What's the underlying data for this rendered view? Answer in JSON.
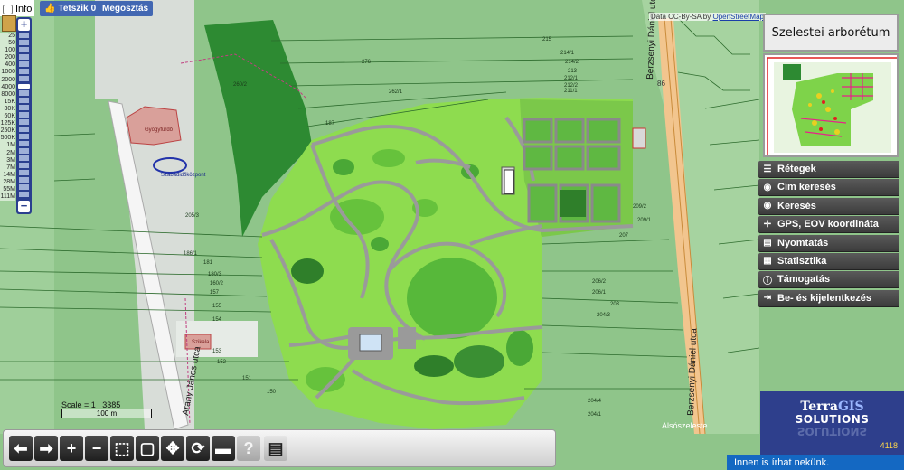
{
  "header": {
    "info_label": "Info",
    "fb_like_label": "Tetszik",
    "fb_like_count": "0",
    "fb_share_label": "Megosztás"
  },
  "zoom": {
    "in_label": "+",
    "out_label": "−",
    "scales": [
      "25",
      "50",
      "100",
      "200",
      "400",
      "1000",
      "2000",
      "4000",
      "8000",
      "15K",
      "30K",
      "60K",
      "125K",
      "250K",
      "500K",
      "1M",
      "2M",
      "3M",
      "7M",
      "14M",
      "28M",
      "55M",
      "111M"
    ],
    "current_scale_index": 7
  },
  "attribution": {
    "prefix": "Data CC-By-SA by",
    "link": "OpenStreetMap"
  },
  "map_labels": {
    "street_1": "Berzsenyi Dániel utca",
    "street_2": "Berzsenyi Dániel utca",
    "street_3": "Arany János utca",
    "street_4": "Alsószeleste",
    "label_gyogyfurdo": "Gyógyfürdő",
    "label_szabadidokozpont": "Szabadidőközpont",
    "label_szikala": "Szikala",
    "road_86": "86",
    "parcels": [
      "215",
      "214/1",
      "214/2",
      "213",
      "212/1",
      "212/2",
      "211/1",
      "209/2",
      "209/1",
      "207",
      "206/2",
      "206/1",
      "204/1",
      "203",
      "204/4",
      "204/3",
      "187",
      "186/1",
      "181",
      "180/3",
      "160/2",
      "157",
      "155",
      "154",
      "153",
      "152",
      "151",
      "150",
      "205/3",
      "276",
      "260/2",
      "262/1"
    ]
  },
  "scale": {
    "label": "Scale = 1 : 3385",
    "bar_label": "100 m"
  },
  "side_panel": {
    "title": "Szelestei arborétum",
    "menu": [
      {
        "icon": "layers-icon",
        "label": "Rétegek"
      },
      {
        "icon": "eye-icon",
        "label": "Cím keresés"
      },
      {
        "icon": "eye-icon",
        "label": "Keresés"
      },
      {
        "icon": "crosshair-icon",
        "label": "GPS, EOV koordináta"
      },
      {
        "icon": "printer-icon",
        "label": "Nyomtatás"
      },
      {
        "icon": "table-icon",
        "label": "Statisztika"
      },
      {
        "icon": "info-icon",
        "label": "Támogatás"
      },
      {
        "icon": "login-icon",
        "label": "Be- és kijelentkezés"
      }
    ]
  },
  "logo": {
    "line1_prefix": "Terra",
    "line1_accent": "GIS",
    "line2": "SOLUTIONS",
    "counter": "4118"
  },
  "chat": {
    "label": "Innen is írhat nekünk."
  },
  "toolbar": {
    "tools": [
      {
        "name": "back-button",
        "glyph": "⬅",
        "state": "active"
      },
      {
        "name": "forward-button",
        "glyph": "➡",
        "state": "active"
      },
      {
        "name": "zoom-in-button",
        "glyph": "+",
        "state": "active"
      },
      {
        "name": "zoom-out-button",
        "glyph": "−",
        "state": "active"
      },
      {
        "name": "zoom-box-button",
        "glyph": "⬚",
        "state": "active"
      },
      {
        "name": "full-extent-button",
        "glyph": "▢",
        "state": "active"
      },
      {
        "name": "pan-button",
        "glyph": "✥",
        "state": "active"
      },
      {
        "name": "rotate-button",
        "glyph": "⟳",
        "state": "active"
      },
      {
        "name": "measure-button",
        "glyph": "▬",
        "state": "active"
      },
      {
        "name": "help-button",
        "glyph": "?",
        "state": "disabled"
      },
      {
        "name": "document-button",
        "glyph": "▤",
        "state": "light"
      }
    ]
  },
  "colors": {
    "park_light": "#8edc4f",
    "park_mid": "#66c23c",
    "park_dark": "#2f7f2a",
    "forest": "#2d8a32",
    "background": "#8fbf8a",
    "panel_dark": "#444444",
    "logo_blue": "#2e3f8c",
    "chat_blue": "#1468c2"
  }
}
